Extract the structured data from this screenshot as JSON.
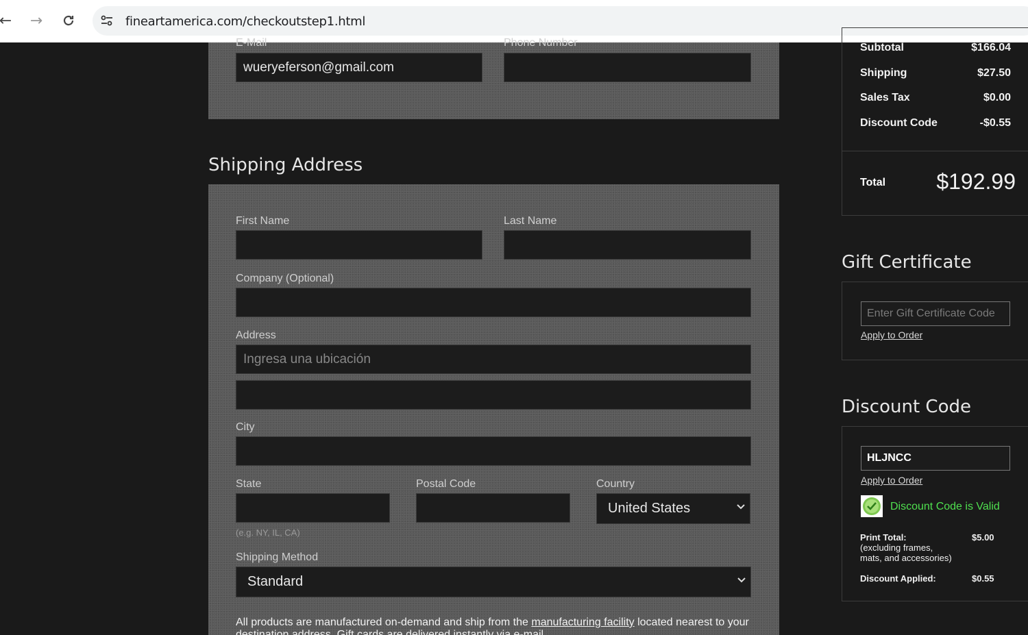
{
  "browser": {
    "url": "fineartamerica.com/checkoutstep1.html"
  },
  "contact": {
    "email_label": "E-Mail",
    "email_value": "wueryeferson@gmail.com",
    "phone_label": "Phone Number",
    "phone_value": ""
  },
  "shipping": {
    "title": "Shipping Address",
    "first_name_label": "First Name",
    "last_name_label": "Last Name",
    "company_label": "Company (Optional)",
    "address_label": "Address",
    "address_placeholder": "Ingresa una ubicación",
    "city_label": "City",
    "state_label": "State",
    "state_hint": "(e.g. NY, IL, CA)",
    "postal_label": "Postal Code",
    "country_label": "Country",
    "country_value": "United States",
    "method_label": "Shipping Method",
    "method_value": "Standard",
    "footnote_before": "All products are manufactured on-demand and ship from the ",
    "footnote_link": "manufacturing facility",
    "footnote_after": " located nearest to your destination address.  Gift cards are delivered instantly via e-mail."
  },
  "summary": {
    "rows": [
      {
        "label": "Subtotal",
        "value": "$166.04"
      },
      {
        "label": "Shipping",
        "value": "$27.50"
      },
      {
        "label": "Sales Tax",
        "value": "$0.00"
      },
      {
        "label": "Discount Code",
        "value": "-$0.55"
      }
    ],
    "total_label": "Total",
    "total_value": "$192.99"
  },
  "gift": {
    "title": "Gift Certificate",
    "placeholder": "Enter Gift Certificate Code",
    "apply": "Apply to Order"
  },
  "discount": {
    "title": "Discount Code",
    "code": "HLJNCC",
    "apply": "Apply to Order",
    "valid_text": "Discount Code is Valid",
    "print_total_label": "Print Total:",
    "print_total_note_1": "(excluding frames,",
    "print_total_note_2": "mats, and accessories)",
    "print_total_value": "$5.00",
    "applied_label": "Discount Applied:",
    "applied_value": "$0.55"
  },
  "colors": {
    "valid_green": "#4fe04f",
    "panel_gray": "#5a5a5a",
    "page_bg": "#1a1a1a"
  }
}
